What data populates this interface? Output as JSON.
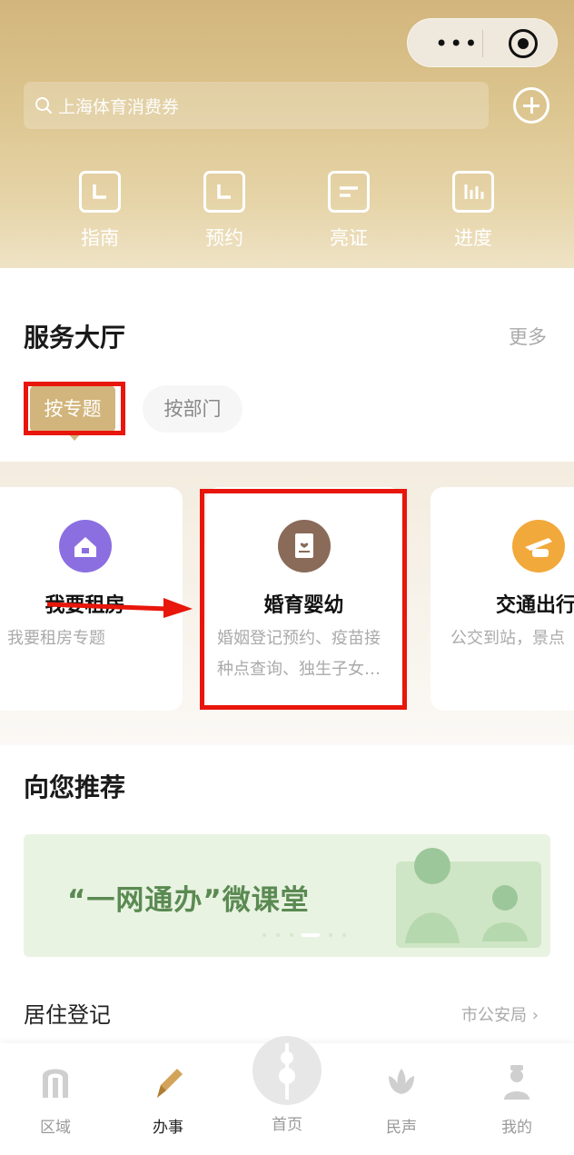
{
  "header": {
    "search_placeholder": "上海体育消费券",
    "quick_actions": [
      {
        "label": "指南",
        "icon": "guide-icon"
      },
      {
        "label": "预约",
        "icon": "appointment-icon"
      },
      {
        "label": "亮证",
        "icon": "certificate-icon"
      },
      {
        "label": "进度",
        "icon": "progress-icon"
      }
    ]
  },
  "service_hall": {
    "title": "服务大厅",
    "more": "更多",
    "tabs": [
      "按专题",
      "按部门"
    ],
    "cards": [
      {
        "title": "我要租房",
        "desc": "我要租房专题",
        "icon": "rent-house-icon",
        "icon_color": "#8b6fe0"
      },
      {
        "title": "婚育婴幼",
        "desc": "婚姻登记预约、疫苗接种点查询、独生子女…",
        "icon": "marriage-certificate-icon",
        "icon_color": "#8a6a58"
      },
      {
        "title": "交通出行",
        "desc": "公交到站，景点",
        "icon": "transport-icon",
        "icon_color": "#f2a93b"
      }
    ]
  },
  "recommend": {
    "title": "向您推荐",
    "banner_text": "“一网通办”微课堂"
  },
  "residence": {
    "title": "居住登记",
    "source": "市公安局"
  },
  "tabbar": {
    "items": [
      {
        "label": "区域",
        "icon": "region-icon"
      },
      {
        "label": "办事",
        "icon": "pen-icon",
        "active": true
      },
      {
        "label": "首页",
        "icon": "home-tower-icon"
      },
      {
        "label": "民声",
        "icon": "lotus-icon"
      },
      {
        "label": "我的",
        "icon": "person-icon"
      }
    ]
  },
  "colors": {
    "header_gold": "#d2b57c",
    "annotation_red": "#e8160b"
  }
}
